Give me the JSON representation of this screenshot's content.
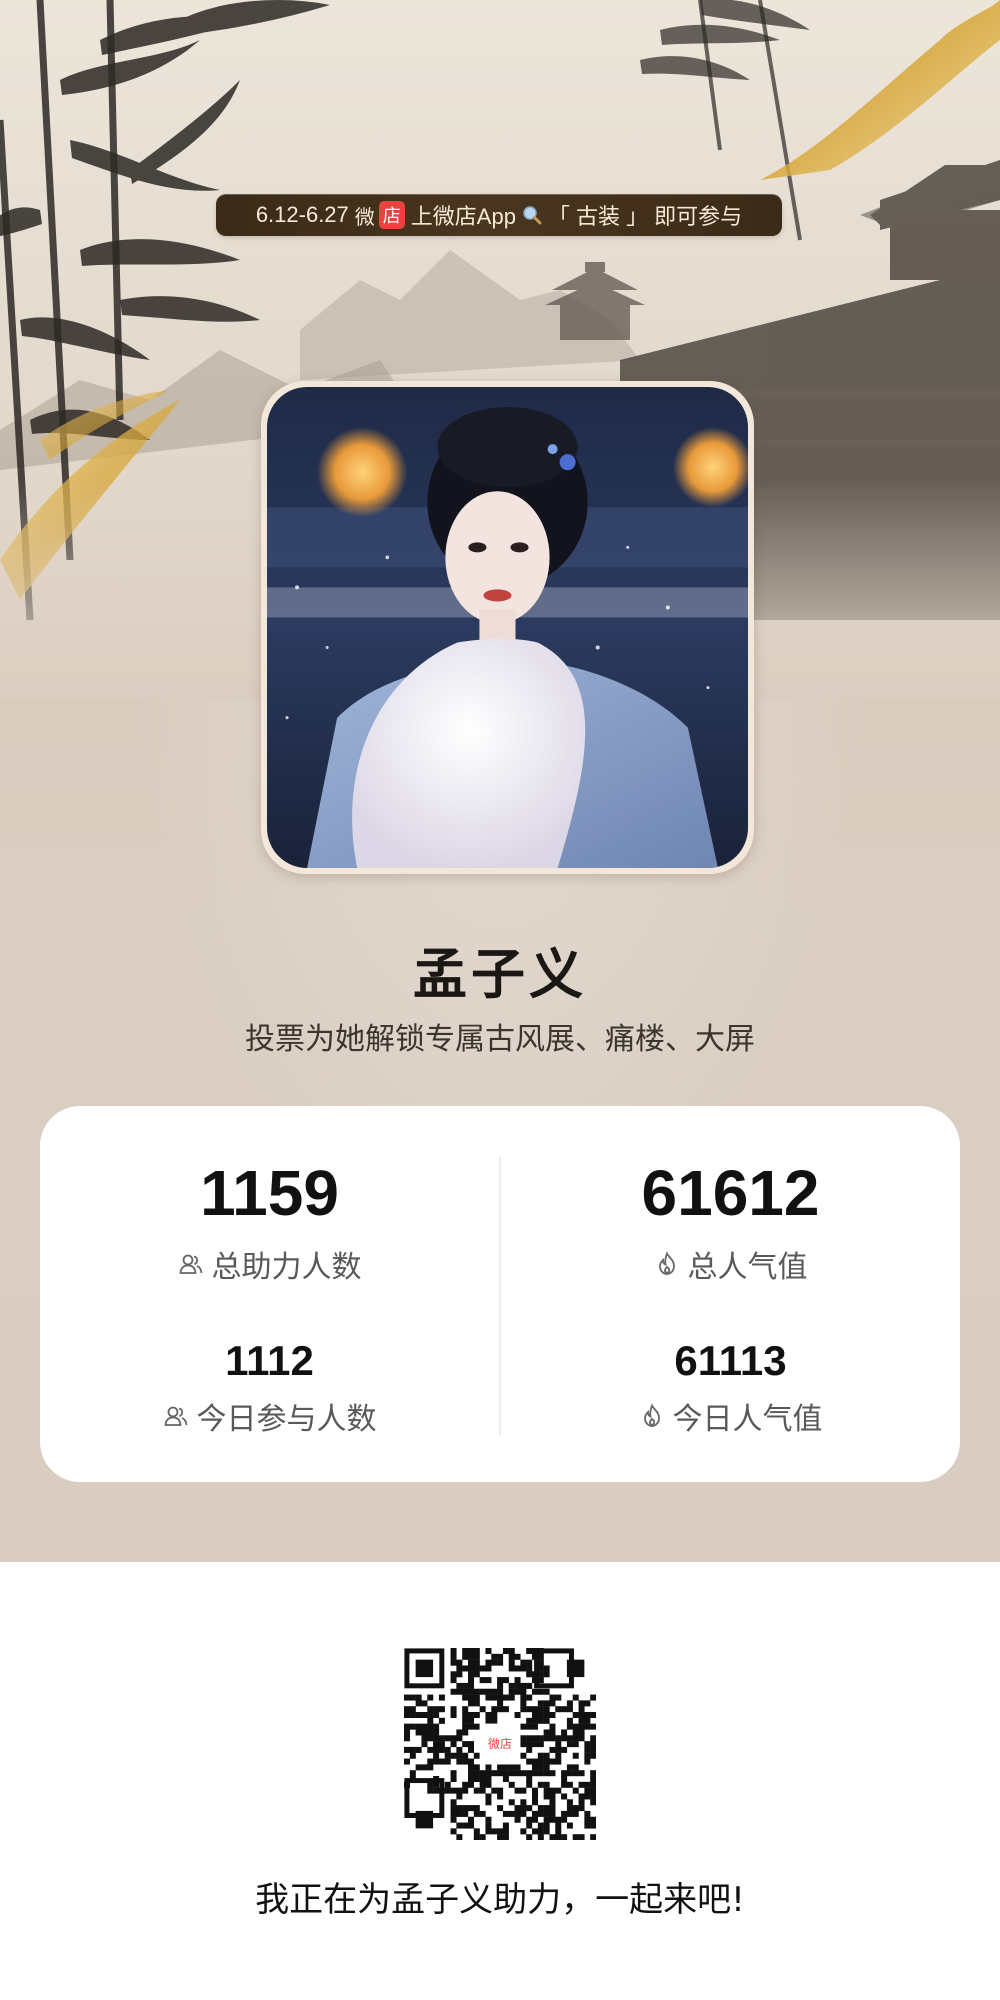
{
  "promo": {
    "dates": "6.12-6.27",
    "badge_left": "微",
    "badge_right": "店",
    "text_before": "上微店App",
    "keyword": "「 古装 」",
    "text_after": "即可参与"
  },
  "profile": {
    "name": "孟子义",
    "subtitle": "投票为她解锁专属古风展、痛楼、大屏"
  },
  "stats": {
    "total_supporters": {
      "value": "1159",
      "label": "总助力人数",
      "icon": "users-icon"
    },
    "total_popularity": {
      "value": "61612",
      "label": "总人气值",
      "icon": "flame-icon"
    },
    "today_participants": {
      "value": "1112",
      "label": "今日参与人数",
      "icon": "users-icon"
    },
    "today_popularity": {
      "value": "61113",
      "label": "今日人气值",
      "icon": "flame-icon"
    }
  },
  "footer": {
    "qr_center": "微店",
    "cta": "我正在为孟子义助力，一起来吧!"
  },
  "colors": {
    "accent_red": "#e8433f",
    "banner_bg": "#3b2a17",
    "poster_bg": "#d9cdc1"
  }
}
